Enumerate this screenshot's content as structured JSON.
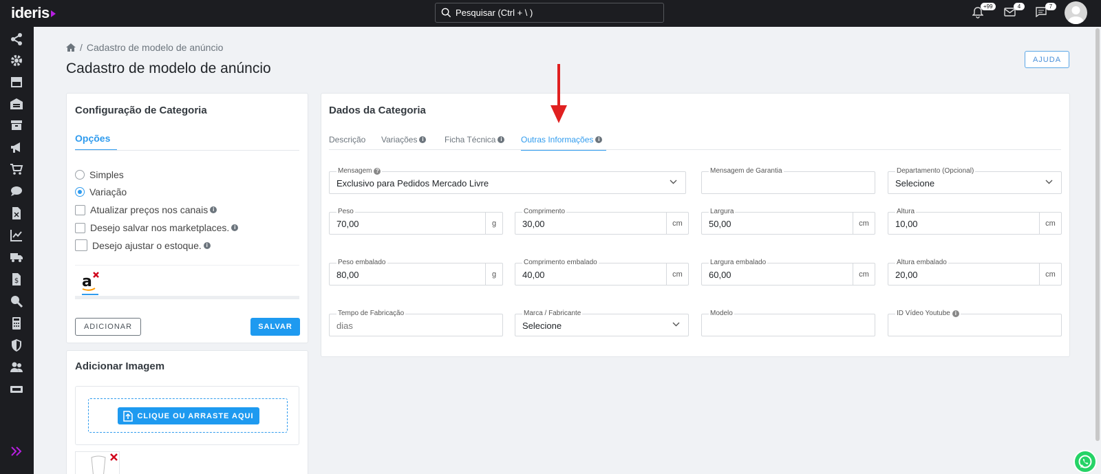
{
  "app": {
    "logo": "ideris"
  },
  "header": {
    "search_placeholder": "Pesquisar (Ctrl + \\ )",
    "notifications_badge": "+99",
    "mail_badge": "4",
    "chat_badge": "7"
  },
  "breadcrumb": {
    "current": "Cadastro de modelo de anúncio"
  },
  "page": {
    "title": "Cadastro de modelo de anúncio",
    "help_button": "AJUDA"
  },
  "config_card": {
    "title": "Configuração de Categoria",
    "tab": "Opções",
    "options": {
      "simple": "Simples",
      "variation": "Variação",
      "update_prices": "Atualizar preços nos canais",
      "save_marketplaces": "Desejo salvar nos marketplaces.",
      "adjust_stock": "Desejo ajustar o estoque."
    },
    "selected_option": "Variação",
    "add_button": "ADICIONAR",
    "save_button": "SALVAR"
  },
  "image_card": {
    "title": "Adicionar Imagem",
    "upload_button": "CLIQUE OU ARRASTE AQUI"
  },
  "data_card": {
    "title": "Dados da Categoria",
    "tabs": [
      "Descrição",
      "Variações",
      "Ficha Técnica",
      "Outras Informações"
    ],
    "active_tab": "Outras Informações",
    "fields": {
      "mensagem": {
        "label": "Mensagem",
        "value": "Exclusivo para Pedidos Mercado Livre"
      },
      "garantia": {
        "label": "Mensagem de Garantia",
        "value": ""
      },
      "departamento": {
        "label": "Departamento (Opcional)",
        "value": "Selecione"
      },
      "peso": {
        "label": "Peso",
        "value": "70,00",
        "unit": "g"
      },
      "comprimento": {
        "label": "Comprimento",
        "value": "30,00",
        "unit": "cm"
      },
      "largura": {
        "label": "Largura",
        "value": "50,00",
        "unit": "cm"
      },
      "altura": {
        "label": "Altura",
        "value": "10,00",
        "unit": "cm"
      },
      "peso_emb": {
        "label": "Peso embalado",
        "value": "80,00",
        "unit": "g"
      },
      "comp_emb": {
        "label": "Comprimento embalado",
        "value": "40,00",
        "unit": "cm"
      },
      "larg_emb": {
        "label": "Largura embalado",
        "value": "60,00",
        "unit": "cm"
      },
      "alt_emb": {
        "label": "Altura embalado",
        "value": "20,00",
        "unit": "cm"
      },
      "fabricacao": {
        "label": "Tempo de Fabricação",
        "placeholder": "dias"
      },
      "marca": {
        "label": "Marca / Fabricante",
        "value": "Selecione"
      },
      "modelo": {
        "label": "Modelo",
        "value": ""
      },
      "youtube": {
        "label": "ID Vídeo Youtube",
        "value": ""
      }
    }
  },
  "colors": {
    "primary": "#1e9af0",
    "topbar": "#1c1d21",
    "accent": "#b620e0",
    "arrow": "#e02020"
  }
}
